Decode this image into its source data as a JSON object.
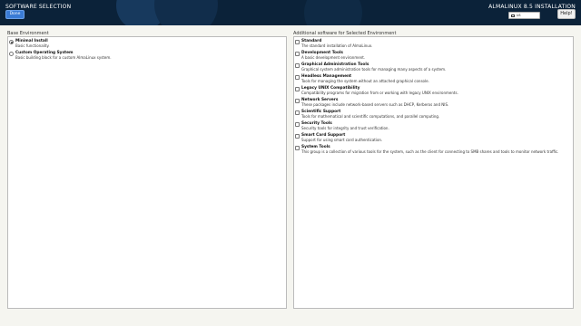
{
  "header": {
    "title": "SOFTWARE SELECTION",
    "done_label": "Done",
    "product": "ALMALINUX 8.5 INSTALLATION",
    "keyboard_layout": "us",
    "help_label": "Help!"
  },
  "base_environment": {
    "heading": "Base Environment",
    "items": [
      {
        "name": "Minimal Install",
        "desc": "Basic functionality.",
        "selected": true
      },
      {
        "name": "Custom Operating System",
        "desc": "Basic building block for a custom AlmaLinux system.",
        "selected": false
      }
    ]
  },
  "additional_software": {
    "heading": "Additional software for Selected Environment",
    "items": [
      {
        "name": "Standard",
        "desc": "The standard installation of AlmaLinux.",
        "checked": false
      },
      {
        "name": "Development Tools",
        "desc": "A basic development environment.",
        "checked": false
      },
      {
        "name": "Graphical Administration Tools",
        "desc": "Graphical system administration tools for managing many aspects of a system.",
        "checked": false
      },
      {
        "name": "Headless Management",
        "desc": "Tools for managing the system without an attached graphical console.",
        "checked": false
      },
      {
        "name": "Legacy UNIX Compatibility",
        "desc": "Compatibility programs for migration from or working with legacy UNIX environments.",
        "checked": false
      },
      {
        "name": "Network Servers",
        "desc": "These packages include network-based servers such as DHCP, Kerberos and NIS.",
        "checked": false
      },
      {
        "name": "Scientific Support",
        "desc": "Tools for mathematical and scientific computations, and parallel computing.",
        "checked": false
      },
      {
        "name": "Security Tools",
        "desc": "Security tools for integrity and trust verification.",
        "checked": false
      },
      {
        "name": "Smart Card Support",
        "desc": "Support for using smart card authentication.",
        "checked": false
      },
      {
        "name": "System Tools",
        "desc": "This group is a collection of various tools for the system, such as the client for connecting to SMB shares and tools to monitor network traffic.",
        "checked": false
      }
    ]
  }
}
